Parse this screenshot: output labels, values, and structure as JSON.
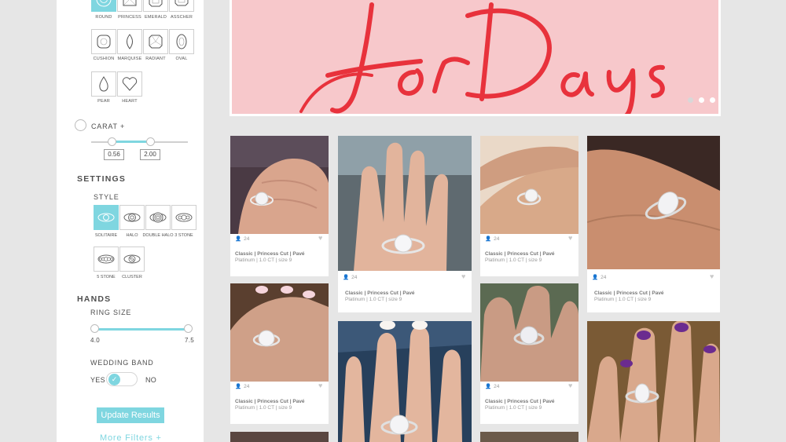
{
  "colors": {
    "accent": "#7fd6e0",
    "banner_pink": "#f7c8cb",
    "script_red": "#e8323c"
  },
  "shapes": [
    {
      "label": "ROUND",
      "icon": "round-diamond-icon",
      "selected": true
    },
    {
      "label": "PRINCESS",
      "icon": "princess-diamond-icon"
    },
    {
      "label": "EMERALD",
      "icon": "emerald-diamond-icon"
    },
    {
      "label": "ASSCHER",
      "icon": "asscher-diamond-icon"
    },
    {
      "label": "CUSHION",
      "icon": "cushion-diamond-icon"
    },
    {
      "label": "MARQUISE",
      "icon": "marquise-diamond-icon"
    },
    {
      "label": "RADIANT",
      "icon": "radiant-diamond-icon"
    },
    {
      "label": "OVAL",
      "icon": "oval-diamond-icon"
    },
    {
      "label": "PEAR",
      "icon": "pear-diamond-icon"
    },
    {
      "label": "HEART",
      "icon": "heart-diamond-icon"
    }
  ],
  "carat": {
    "label": "CARAT",
    "plus": "+",
    "min": "0.56",
    "max": "2.00"
  },
  "settings": {
    "title": "SETTINGS",
    "style_label": "STYLE",
    "styles": [
      {
        "label": "SOLITAIRE",
        "icon": "solitaire-ring-icon",
        "selected": true
      },
      {
        "label": "HALO",
        "icon": "halo-ring-icon"
      },
      {
        "label": "DOUBLE HALO",
        "icon": "double-halo-ring-icon"
      },
      {
        "label": "3 STONE",
        "icon": "three-stone-ring-icon"
      },
      {
        "label": "5 STONE",
        "icon": "five-stone-ring-icon"
      },
      {
        "label": "CLUSTER",
        "icon": "cluster-ring-icon"
      }
    ]
  },
  "hands": {
    "title": "HANDS",
    "ring_size_label": "RING SIZE",
    "ring_min": "4.0",
    "ring_max": "7.5",
    "wedding_band_label": "WEDDING BAND",
    "yes": "YES",
    "no": "NO"
  },
  "update_button": "Update Results",
  "more_filters": "More Filters +",
  "banner": {
    "script_text": "for Days",
    "dots": 4
  },
  "cards": [
    {
      "likes": "24",
      "title": "Classic | Princess Cut | Pavé",
      "sub": "Platinum | 1.0 CT | size 9"
    },
    {
      "likes": "24",
      "title": "Classic | Princess Cut | Pavé",
      "sub": "Platinum | 1.0 CT | size 9"
    },
    {
      "likes": "24",
      "title": "Classic | Princess Cut | Pavé",
      "sub": "Platinum | 1.0 CT | size 9"
    },
    {
      "likes": "24",
      "title": "Classic | Princess Cut | Pavé",
      "sub": "Platinum | 1.0 CT | size 9"
    },
    {
      "likes": "24",
      "title": "Classic | Princess Cut | Pavé",
      "sub": "Platinum | 1.0 CT | size 9"
    },
    {
      "likes": "24",
      "title": "Classic | Princess Cut | Pavé",
      "sub": "Platinum | 1.0 CT | size 9"
    }
  ]
}
